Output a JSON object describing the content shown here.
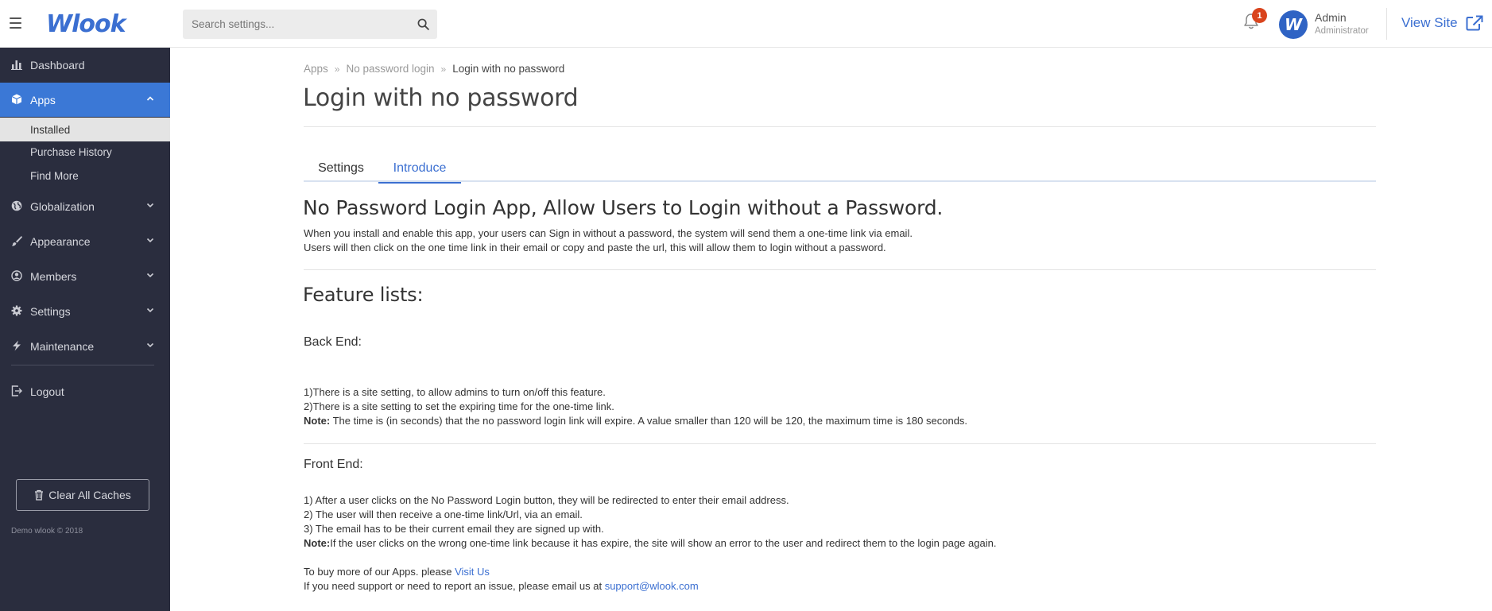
{
  "topbar": {
    "logo": "Wlook",
    "search_placeholder": "Search settings...",
    "notification_count": "1",
    "avatar_letter": "W",
    "user_name": "Admin",
    "user_role": "Administrator",
    "view_site": "View Site"
  },
  "sidebar": {
    "dashboard": "Dashboard",
    "apps": "Apps",
    "apps_sub": [
      "Installed",
      "Purchase History",
      "Find More"
    ],
    "globalization": "Globalization",
    "appearance": "Appearance",
    "members": "Members",
    "settings": "Settings",
    "maintenance": "Maintenance",
    "logout": "Logout",
    "clear_caches": "Clear All Caches",
    "copyright": "Demo wlook © 2018"
  },
  "breadcrumb": [
    "Apps",
    "No password login",
    "Login with no password"
  ],
  "page_title": "Login with no password",
  "tabs": [
    "Settings",
    "Introduce"
  ],
  "active_tab": "Introduce",
  "intro": {
    "heading": "No Password Login App, Allow Users to Login without a Password.",
    "line1": "When you install and enable this app, your users can Sign in without a password, the system will send them a one-time link via email.",
    "line2": "Users will then click on the one time link in their email or copy and paste the url, this will allow them to login without a password."
  },
  "features": {
    "heading": "Feature lists:",
    "backend_title": "Back End:",
    "backend_items": [
      "1)There is a site setting, to allow admins to turn on/off this feature.",
      "2)There is a site setting to set the expiring time for the one-time link."
    ],
    "backend_note_label": "Note:",
    "backend_note": " The time is (in seconds) that the no password login link will expire. A value smaller than 120 will be 120, the maximum time is 180 seconds.",
    "frontend_title": "Front End:",
    "frontend_items": [
      "1) After a user clicks on the No Password Login button, they will be redirected to enter their email address.",
      "2) The user will then receive a one-time link/Url, via an email.",
      "3) The email has to be their current email they are signed up with."
    ],
    "frontend_note_label": "Note:",
    "frontend_note": "If the user clicks on the wrong one-time link because it has expire, the site will show an error to the user and redirect them to the login page again."
  },
  "footer": {
    "buy_text": "To buy more of our Apps. please ",
    "buy_link": "Visit Us",
    "support_text": "If you need support or need to report an issue, please email us at ",
    "support_link": "support@wlook.com"
  },
  "colors": {
    "accent": "#3b6fd1",
    "sidebar_bg": "#2a2d3e",
    "sidebar_active": "#3b78d6",
    "badge": "#d9441d"
  },
  "icons": {
    "menu": "hamburger-icon",
    "search": "search-icon",
    "notifications": "bell-icon",
    "external": "external-link-icon",
    "dashboard": "bar-chart-icon",
    "apps": "cube-icon",
    "globalization": "globe-icon",
    "appearance": "brush-icon",
    "members": "user-circle-icon",
    "settings": "gear-icon",
    "maintenance": "bolt-icon",
    "logout": "logout-icon",
    "clear_caches": "trash-icon"
  }
}
